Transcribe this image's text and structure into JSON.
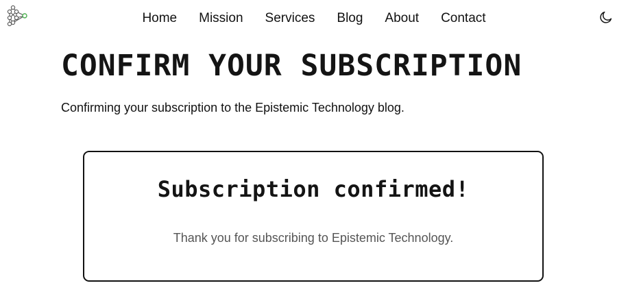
{
  "header": {
    "logo_icon": "network-nodes-logo-icon",
    "logo_accent_color": "#4caf50",
    "nav": [
      {
        "label": "Home"
      },
      {
        "label": "Mission"
      },
      {
        "label": "Services"
      },
      {
        "label": "Blog"
      },
      {
        "label": "About"
      },
      {
        "label": "Contact"
      }
    ],
    "theme_toggle_icon": "moon-icon"
  },
  "main": {
    "title": "CONFIRM YOUR SUBSCRIPTION",
    "subtitle": "Confirming your subscription to the Epistemic Technology blog.",
    "card": {
      "heading": "Subscription confirmed!",
      "message": "Thank you for subscribing to Epistemic Technology."
    }
  }
}
